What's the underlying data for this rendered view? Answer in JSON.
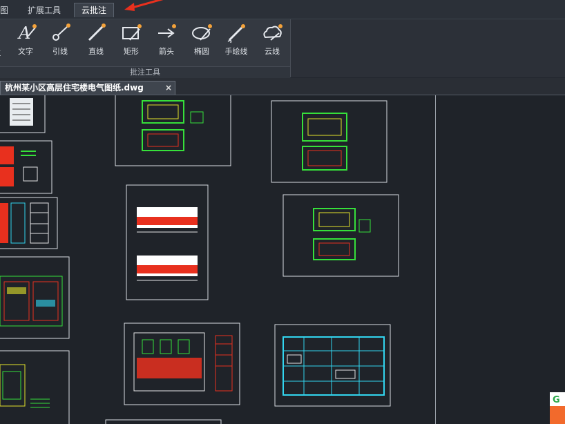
{
  "menu": {
    "tabs": [
      {
        "label": "图"
      },
      {
        "label": "扩展工具"
      },
      {
        "label": "云批注"
      }
    ],
    "active": "云批注"
  },
  "ribbon": {
    "partial_left_label": "主",
    "tools": [
      {
        "label": "文字",
        "icon": "text-annotate-icon"
      },
      {
        "label": "引线",
        "icon": "leader-line-icon"
      },
      {
        "label": "直线",
        "icon": "straight-line-icon"
      },
      {
        "label": "矩形",
        "icon": "rectangle-icon"
      },
      {
        "label": "箭头",
        "icon": "arrow-icon"
      },
      {
        "label": "椭圆",
        "icon": "ellipse-icon"
      },
      {
        "label": "手绘线",
        "icon": "freehand-line-icon"
      },
      {
        "label": "云线",
        "icon": "cloud-line-icon"
      }
    ],
    "group_label": "批注工具"
  },
  "document": {
    "tab_title": "杭州某小区高层住宅楼电气图纸.dwg",
    "close_glyph": "×"
  },
  "colors": {
    "ribbon_bg": "#343941",
    "canvas_bg": "#1f2329",
    "accent_red": "#e8301e",
    "line_green": "#36e03a",
    "line_yellow": "#e3e32a",
    "line_cyan": "#32d6f0",
    "icon_orange": "#f4a23a"
  }
}
